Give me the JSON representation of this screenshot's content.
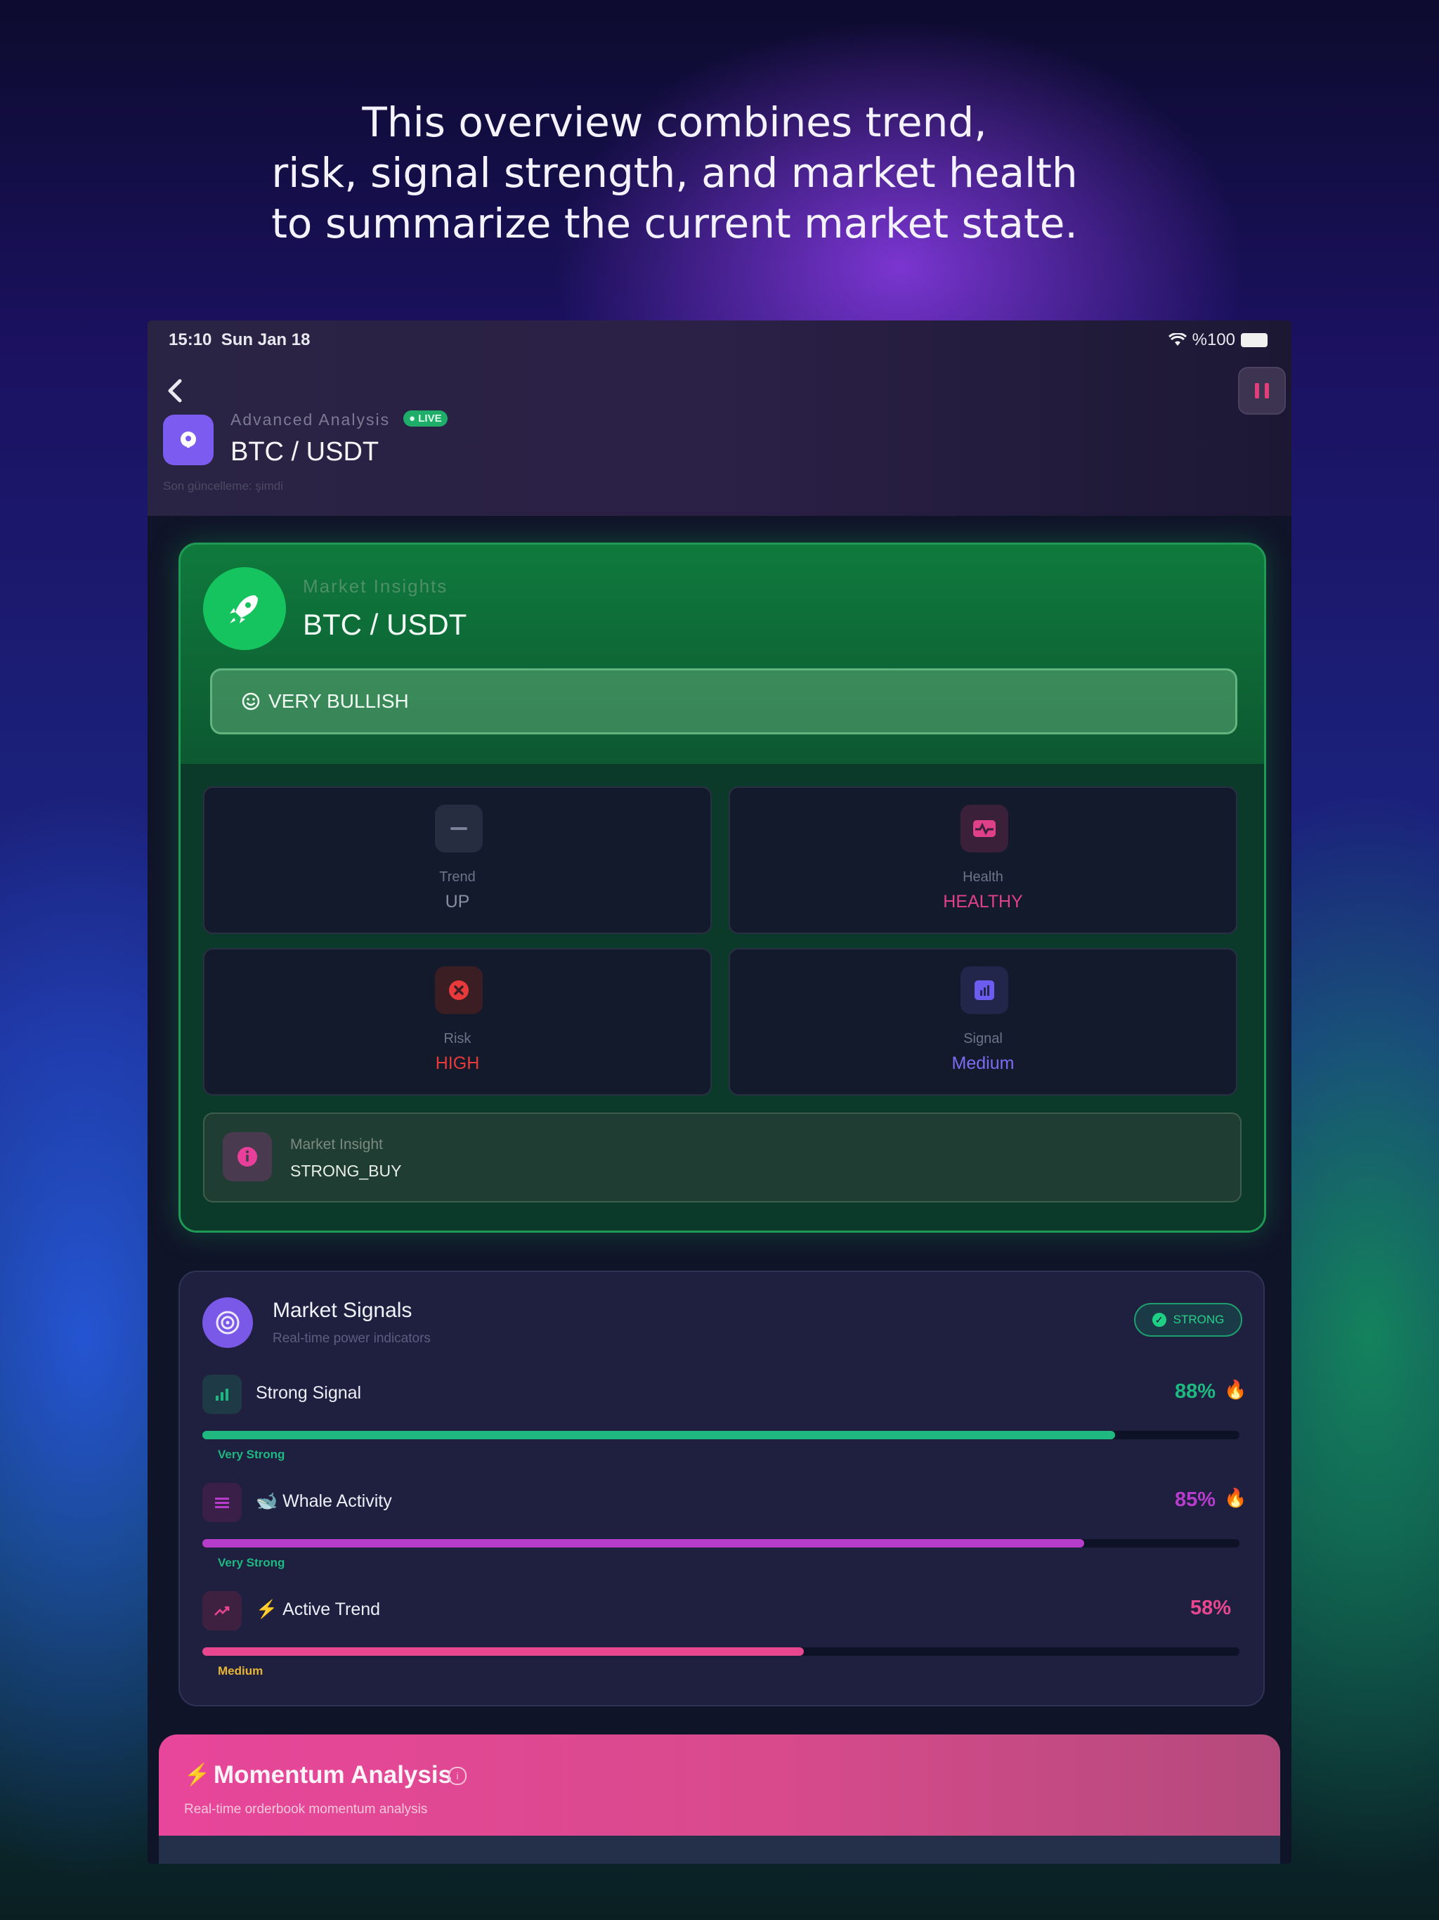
{
  "headline": {
    "line1": "This overview combines trend,",
    "line2": "risk, signal strength, and market health",
    "line3": "to summarize the current market state."
  },
  "status_bar": {
    "time": "15:10",
    "date": "Sun Jan 18",
    "battery": "%100"
  },
  "header": {
    "section_label": "Advanced Analysis",
    "live_badge": "LIVE",
    "pair": "BTC / USDT",
    "last_update": "Son güncelleme: şimdi"
  },
  "insights": {
    "label": "Market Insights",
    "pair": "BTC / USDT",
    "sentiment": "VERY BULLISH",
    "tiles": [
      {
        "label": "Trend",
        "value": "UP",
        "color": "#8a8fa4",
        "icon": "minus-icon"
      },
      {
        "label": "Health",
        "value": "HEALTHY",
        "color": "#e0408a",
        "icon": "heart-pulse-icon"
      },
      {
        "label": "Risk",
        "value": "HIGH",
        "color": "#e83a3a",
        "icon": "x-circle-icon"
      },
      {
        "label": "Signal",
        "value": "Medium",
        "color": "#7c6cf2",
        "icon": "bar-chart-icon"
      }
    ],
    "market_insight_label": "Market Insight",
    "market_insight_value": "STRONG_BUY"
  },
  "signals": {
    "title": "Market Signals",
    "subtitle": "Real-time power indicators",
    "badge": "STRONG",
    "rows": [
      {
        "label": "Strong Signal",
        "percent_text": "88%",
        "percent": 88,
        "tag": "Very Strong",
        "color": "#1fb880",
        "tag_color": "#1fb880",
        "icon": "signal-bars-icon",
        "fire": true
      },
      {
        "label": "Whale Activity",
        "percent_text": "85%",
        "percent": 85,
        "tag": "Very Strong",
        "color": "#b63ccc",
        "tag_color": "#1fb880",
        "icon": "whale-icon",
        "fire": true
      },
      {
        "label": "Active Trend",
        "percent_text": "58%",
        "percent": 58,
        "tag": "Medium",
        "color": "#e8478f",
        "tag_color": "#e8b634",
        "icon": "trend-up-icon",
        "fire": false
      }
    ]
  },
  "momentum": {
    "title": "Momentum Analysis",
    "subtitle": "Real-time orderbook momentum analysis"
  }
}
